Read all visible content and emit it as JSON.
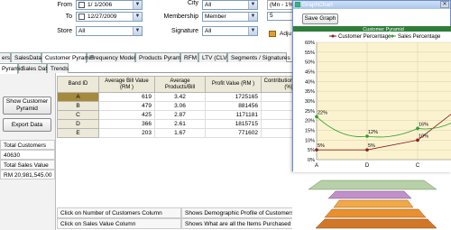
{
  "filters": {
    "from_label": "From",
    "from_value": "1/ 1/2006",
    "to_label": "To",
    "to_value": "12/27/2009",
    "store_label": "Store",
    "store_value": "All",
    "city_label": "City",
    "city_value": "All",
    "membership_label": "Membership",
    "membership_value": "Member",
    "signature_label": "Signature",
    "signature_value": "All",
    "range_value": "(Mn - 1%, Mx",
    "range_input": "5",
    "adj_label": "Adju"
  },
  "main_tabs": [
    "ers",
    "SalesData",
    "Customer Pyramid",
    "Frequency Modeling",
    "Products Pyramid",
    "RFM",
    "LTV (CLV)",
    "Segments / Signatures"
  ],
  "sub_tabs": [
    "Pyramid",
    "Sales Data",
    "Trends"
  ],
  "left": {
    "show_button": "Show Customer Pyramid",
    "export_button": "Export Data",
    "total_customers_label": "Total Customers",
    "total_customers_value": "40630",
    "total_sales_label": "Total Sales Value",
    "total_sales_value": "RM  20,981,545.00"
  },
  "grid": {
    "headers": [
      "Band ID",
      "Average Bill Value (RM )",
      "Average Products/Bill",
      "Profit Value (RM )",
      "Contribution to Profit (%)"
    ],
    "rows": [
      {
        "band": "A",
        "bill": "619",
        "products": "3.42",
        "profit": "1725165",
        "contrib": "27.1"
      },
      {
        "band": "B",
        "bill": "479",
        "products": "3.06",
        "profit": "881456",
        "contrib": "13.85"
      },
      {
        "band": "C",
        "bill": "425",
        "products": "2.87",
        "profit": "1171181",
        "contrib": "18.4"
      },
      {
        "band": "D",
        "bill": "366",
        "profit": "1815715",
        "products": "2.61",
        "contrib": "28.53"
      },
      {
        "band": "E",
        "bill": "203",
        "products": "1.67",
        "profit": "771602",
        "contrib": "12.12"
      }
    ]
  },
  "info": {
    "r1c1": "Click on Number of Customers Column",
    "r1c2": "Shows Demographic Profile of Customers",
    "r2c1": "Click on Sales Value Column",
    "r2c2": "Shows What are all the Items Purchased"
  },
  "graph": {
    "window_title": "GraphChart",
    "save_button": "Save Graph",
    "close_glyph": "✕"
  },
  "chart_data": {
    "type": "line",
    "title": "Customer Pyramid",
    "categories": [
      "A",
      "B",
      "C",
      "D"
    ],
    "ylim": [
      0,
      60
    ],
    "yticks": [
      "0%",
      "5%",
      "10%",
      "15%",
      "20%",
      "25%",
      "30%",
      "35%",
      "40%",
      "45%",
      "50%",
      "55%",
      "60%"
    ],
    "series": [
      {
        "name": "Customer Percentage",
        "color": "#8b1a1a",
        "values": [
          5,
          5,
          10,
          30
        ],
        "labels": [
          "5%",
          "5%",
          "10%",
          ""
        ]
      },
      {
        "name": "Sales Percentage",
        "color": "#2e9e2e",
        "values": [
          22,
          12,
          16,
          24
        ],
        "labels": [
          "22%",
          "12%",
          "16%",
          ""
        ]
      }
    ],
    "x_axis_labels": [
      "A",
      "D",
      "C",
      ""
    ],
    "grid": true,
    "legend": "top"
  }
}
